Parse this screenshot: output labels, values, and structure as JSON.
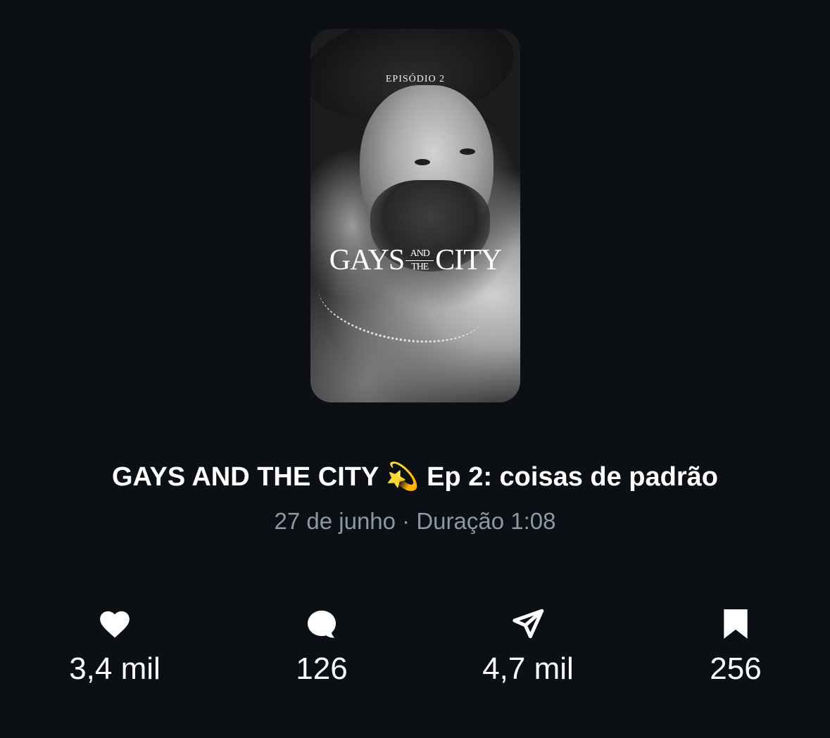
{
  "cover": {
    "episode_label": "EPISÓDIO 2",
    "show_title_left": "GAYS",
    "show_title_and": "AND",
    "show_title_the": "THE",
    "show_title_right": "CITY"
  },
  "post": {
    "title": "GAYS AND THE CITY 💫 Ep 2: coisas de padrão",
    "meta": "27 de junho · Duração 1:08"
  },
  "stats": {
    "likes": "3,4 mil",
    "replies": "126",
    "shares": "4,7 mil",
    "bookmarks": "256"
  },
  "icons": {
    "like": "heart-icon",
    "reply": "speech-bubble-icon",
    "share": "send-icon",
    "bookmark": "bookmark-icon"
  },
  "colors": {
    "background": "#0c0f14",
    "text_primary": "#ffffff",
    "text_secondary": "#8b98a5"
  }
}
